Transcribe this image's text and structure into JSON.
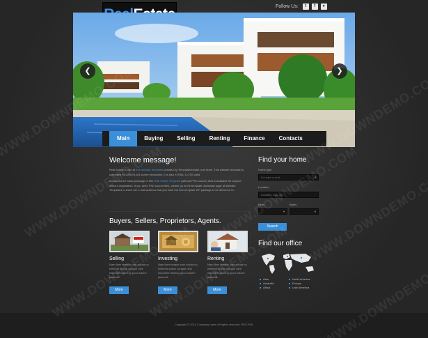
{
  "logo": {
    "part1": "Real",
    "part2": "Estate"
  },
  "social": {
    "label": "Follow Us:",
    "icons": [
      "twitter-icon",
      "facebook-icon",
      "rss-icon"
    ]
  },
  "nav": {
    "items": [
      "Main",
      "Buying",
      "Selling",
      "Renting",
      "Finance",
      "Contacts"
    ],
    "active": "Main"
  },
  "welcome": {
    "title": "Welcome message!",
    "p1_a": "Real Estate is one of",
    "p1_link": "free website templates",
    "p1_b": "created by TemplateMonster.com team. This website template is optimized for 1280X1024 screen resolution. It is also XHTML & CSS valid.",
    "p2_a": "Download the basic package of this",
    "p2_link": "Real Estate Template",
    "p2_b": "(without PSD source) that is available for anyone without registration. If you need PSD source files, please go to the template download page at Website Templates to leave the e-mail address that you want the free template ZIP package to be delivered to."
  },
  "buyers": {
    "title": "Buyers, Sellers, Proprietors, Agents."
  },
  "cards": [
    {
      "title": "Selling",
      "text": "Nam liber tempor cum soluta no eleifend option congue nihil imperdiet doming quod mazim placerat.",
      "button": "More"
    },
    {
      "title": "Investing",
      "text": "Nam liber tempor cum soluta no eleifend option congue nihil imperdiet doming quod mazim placerat.",
      "button": "More"
    },
    {
      "title": "Renting",
      "text": "Nam liber tempor cum soluta no eleifend option congue nihil imperdiet doming quod mazim placerat.",
      "button": "More"
    }
  ],
  "find_home": {
    "title": "Find your home",
    "home_type_label": "Home type",
    "home_type_value": "For sale or rent",
    "location_label": "Location",
    "location_value": "Location, City, Zip",
    "beds_label": "Beds",
    "baths_label": "Baths",
    "search_button": "Search"
  },
  "office": {
    "title": "Find our office",
    "regions_left": [
      "Asia",
      "Australia",
      "Africa"
    ],
    "regions_right": [
      "North America",
      "Europe",
      "Latin America"
    ]
  },
  "footer": {
    "copyright": "Copyright © 2010 Company name All rights reserved. RSS.XML"
  },
  "watermark": "WWW.DOWNDEMO.COM",
  "colors": {
    "accent": "#3b8fd8",
    "background": "#2b2b2b",
    "footer": "#1e1e1e"
  }
}
